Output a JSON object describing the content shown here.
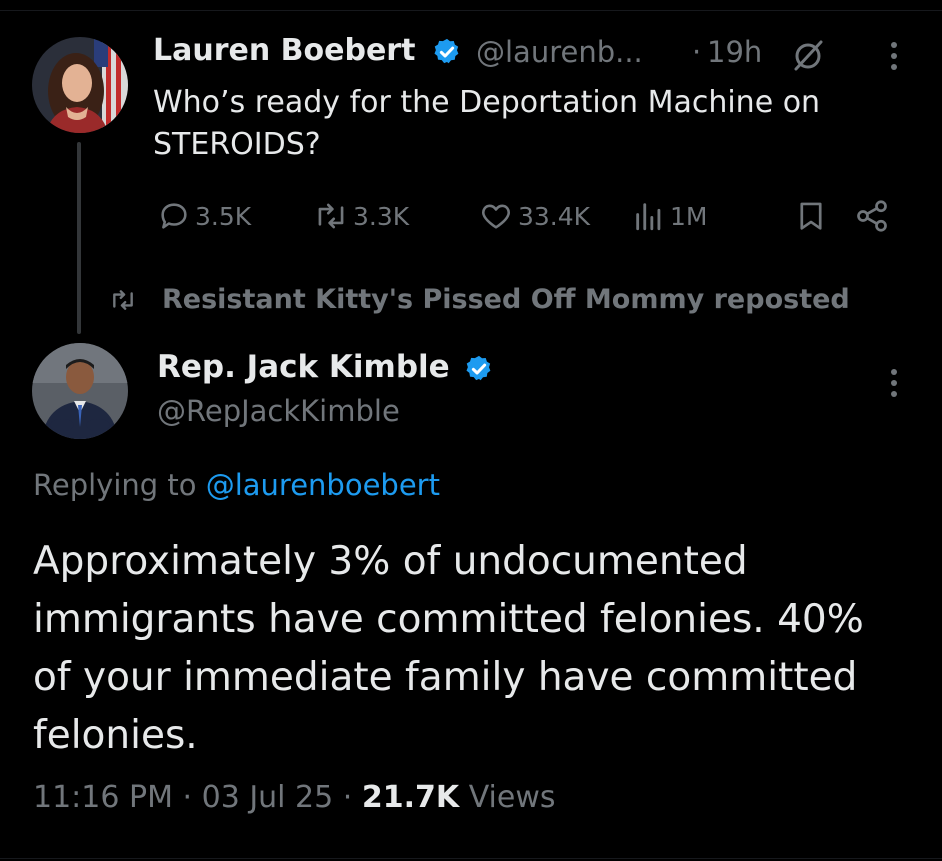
{
  "quoted": {
    "name": "Lauren Boebert",
    "handle": "@laurenb...",
    "dot": "·",
    "time": "19h",
    "text": "Who’s ready for the Deportation Machine on STEROIDS?",
    "metrics": {
      "replies": "3.5K",
      "reposts": "3.3K",
      "likes": "33.4K",
      "views": "1M"
    }
  },
  "repost_banner": {
    "text": "Resistant Kitty's Pissed Off Mommy reposted"
  },
  "post": {
    "name": "Rep. Jack Kimble",
    "handle": "@RepJackKimble",
    "reply_prefix": "Replying to",
    "reply_to": "@laurenboebert",
    "text": "Approximately 3% of undocumented immigrants have committed felonies. 40% of your immediate family have committed felonies.",
    "time": "11:16 PM",
    "sep1": "·",
    "date": "03 Jul 25",
    "sep2": "·",
    "views_count": "21.7K",
    "views_label": "Views"
  },
  "colors": {
    "background": "#000000",
    "text": "#e7e9ea",
    "muted": "#71767b",
    "link": "#1d9bf0",
    "verified": "#1d9bf0"
  }
}
